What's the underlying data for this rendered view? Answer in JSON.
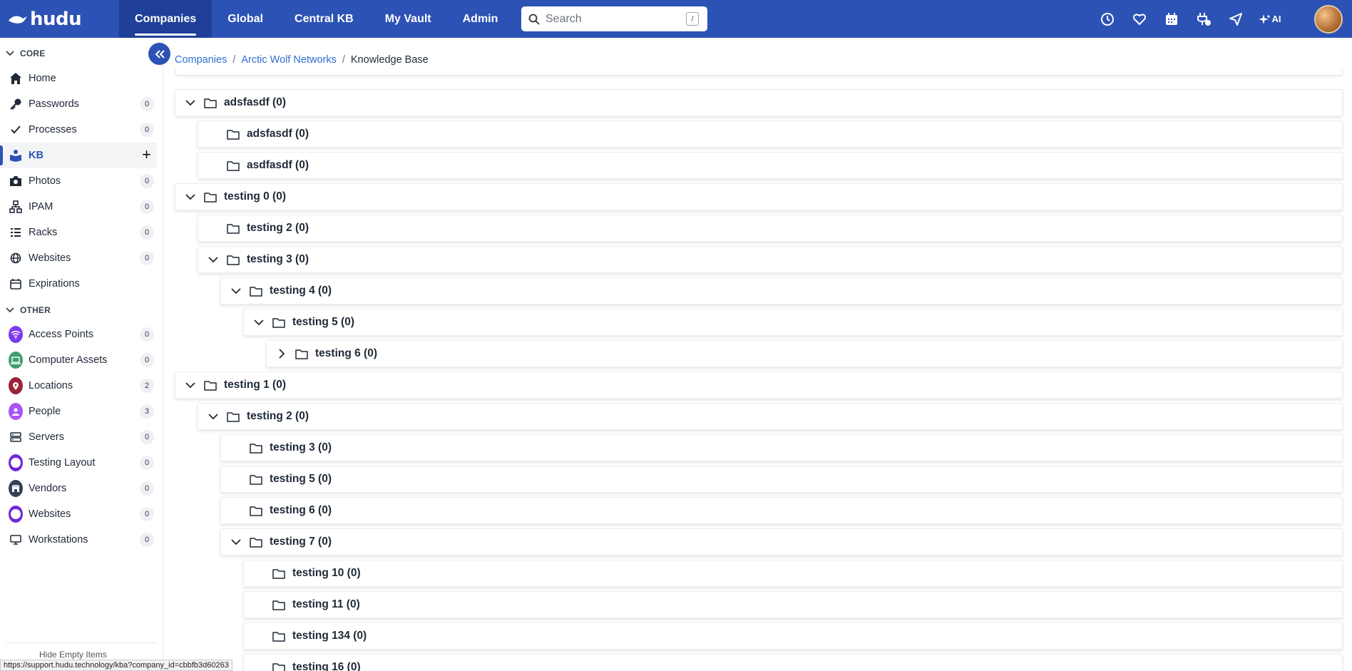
{
  "brand": "hudu",
  "nav": {
    "tabs": [
      "Companies",
      "Global",
      "Central KB",
      "My Vault",
      "Admin"
    ],
    "active": 0,
    "search_placeholder": "Search",
    "search_shortcut": "/",
    "ai_label": "AI"
  },
  "sidebar": {
    "core_title": "CORE",
    "other_title": "OTHER",
    "core": [
      {
        "label": "Home",
        "count": ""
      },
      {
        "label": "Passwords",
        "count": "0"
      },
      {
        "label": "Processes",
        "count": "0"
      },
      {
        "label": "KB",
        "count": ""
      },
      {
        "label": "Photos",
        "count": "0"
      },
      {
        "label": "IPAM",
        "count": "0"
      },
      {
        "label": "Racks",
        "count": "0"
      },
      {
        "label": "Websites",
        "count": "0"
      },
      {
        "label": "Expirations",
        "count": ""
      }
    ],
    "other": [
      {
        "label": "Access Points",
        "count": "0"
      },
      {
        "label": "Computer Assets",
        "count": "0"
      },
      {
        "label": "Locations",
        "count": "2"
      },
      {
        "label": "People",
        "count": "3"
      },
      {
        "label": "Servers",
        "count": "0"
      },
      {
        "label": "Testing Layout",
        "count": "0"
      },
      {
        "label": "Vendors",
        "count": "0"
      },
      {
        "label": "Websites",
        "count": "0"
      },
      {
        "label": "Workstations",
        "count": "0"
      }
    ],
    "hide_empty": "Hide Empty Items",
    "plus": "+"
  },
  "breadcrumb": {
    "items": [
      "Companies",
      "Arctic Wolf Networks"
    ],
    "current": "Knowledge Base"
  },
  "folders": [
    {
      "label": "adsfasdf (0)",
      "depth": 0,
      "state": "open"
    },
    {
      "label": "adsfasdf (0)",
      "depth": 1,
      "state": "leaf"
    },
    {
      "label": "asdfasdf (0)",
      "depth": 1,
      "state": "leaf"
    },
    {
      "label": "testing 0 (0)",
      "depth": 0,
      "state": "open"
    },
    {
      "label": "testing 2 (0)",
      "depth": 1,
      "state": "leaf"
    },
    {
      "label": "testing 3 (0)",
      "depth": 1,
      "state": "open"
    },
    {
      "label": "testing 4 (0)",
      "depth": 2,
      "state": "open"
    },
    {
      "label": "testing 5 (0)",
      "depth": 3,
      "state": "open"
    },
    {
      "label": "testing 6 (0)",
      "depth": 4,
      "state": "closed"
    },
    {
      "label": "testing 1 (0)",
      "depth": 0,
      "state": "open"
    },
    {
      "label": "testing 2 (0)",
      "depth": 1,
      "state": "open"
    },
    {
      "label": "testing 3 (0)",
      "depth": 2,
      "state": "leaf"
    },
    {
      "label": "testing 5 (0)",
      "depth": 2,
      "state": "leaf"
    },
    {
      "label": "testing 6 (0)",
      "depth": 2,
      "state": "leaf"
    },
    {
      "label": "testing 7 (0)",
      "depth": 2,
      "state": "open"
    },
    {
      "label": "testing 10 (0)",
      "depth": 3,
      "state": "leaf"
    },
    {
      "label": "testing 11 (0)",
      "depth": 3,
      "state": "leaf"
    },
    {
      "label": "testing 134 (0)",
      "depth": 3,
      "state": "leaf"
    },
    {
      "label": "testing 16 (0)",
      "depth": 3,
      "state": "leaf"
    }
  ],
  "status_url": "https://support.hudu.technology/kba?company_id=cbbfb3d60263",
  "colors": {
    "brand": "#2d52b5",
    "access_points": "#7c3aed",
    "computer_assets": "#3f9f6f",
    "locations": "#9b2335",
    "people": "#a855f7",
    "testing_layout": "#6d28d9",
    "vendors": "#334155",
    "websites_other": "#6d28d9"
  }
}
